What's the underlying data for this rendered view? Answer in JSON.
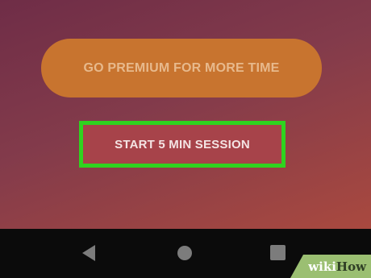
{
  "screen": {
    "premium_label": "GO PREMIUM FOR MORE TIME",
    "session_label": "START 5 MIN SESSION"
  },
  "navbar": {
    "back_icon": "triangle-back",
    "home_icon": "circle-home",
    "recents_icon": "square-recents"
  },
  "watermark": {
    "part1": "wiki",
    "part2": "How"
  },
  "colors": {
    "premium_button": "#c8742f",
    "highlight_border": "#2fd31f",
    "session_button": "#a7434a",
    "navbar": "#0b0b0b"
  }
}
